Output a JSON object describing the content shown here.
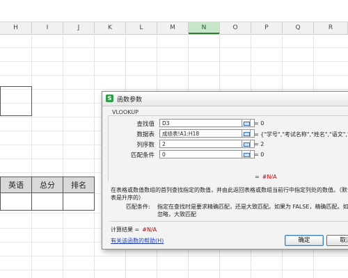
{
  "columns": [
    "H",
    "I",
    "J",
    "K",
    "L",
    "M",
    "N",
    "O",
    "P",
    "Q",
    "R"
  ],
  "active_column": "N",
  "table_headers": [
    "英语",
    "总分",
    "排名"
  ],
  "dialog": {
    "title": "函数参数",
    "function_name": "VLOOKUP",
    "args": [
      {
        "label": "查找值",
        "value": "D3",
        "result": "= 0"
      },
      {
        "label": "数据表",
        "value": "成绩表!A1:H18",
        "result": "= {\"学号\",\"考试名称\",\"姓名\",\"语文\",\""
      },
      {
        "label": "列序数",
        "value": "2",
        "result": "= 2"
      },
      {
        "label": "匹配条件",
        "value": "0",
        "result": "= 0"
      }
    ],
    "mid_result_eq": "=",
    "mid_result_value": "#N/A",
    "description_line1": "在表格或数值数组的首列查找指定的数值，并由此返回表格或数组当前行中指定列处的数值。（默认情况",
    "description_line2": "表是升序的）",
    "param_label": "匹配条件:",
    "param_desc_line1": "指定在查找时是要求精确匹配，还是大致匹配。如果为 FALSE，精确匹配。如果为 TR",
    "param_desc_line2": "忽略，大致匹配",
    "calc_result_label": "计算结果 =",
    "calc_result_value": "#N/A",
    "help_link": "有关该函数的帮助(H)",
    "ok_label": "确定",
    "cancel_label": "取消"
  }
}
